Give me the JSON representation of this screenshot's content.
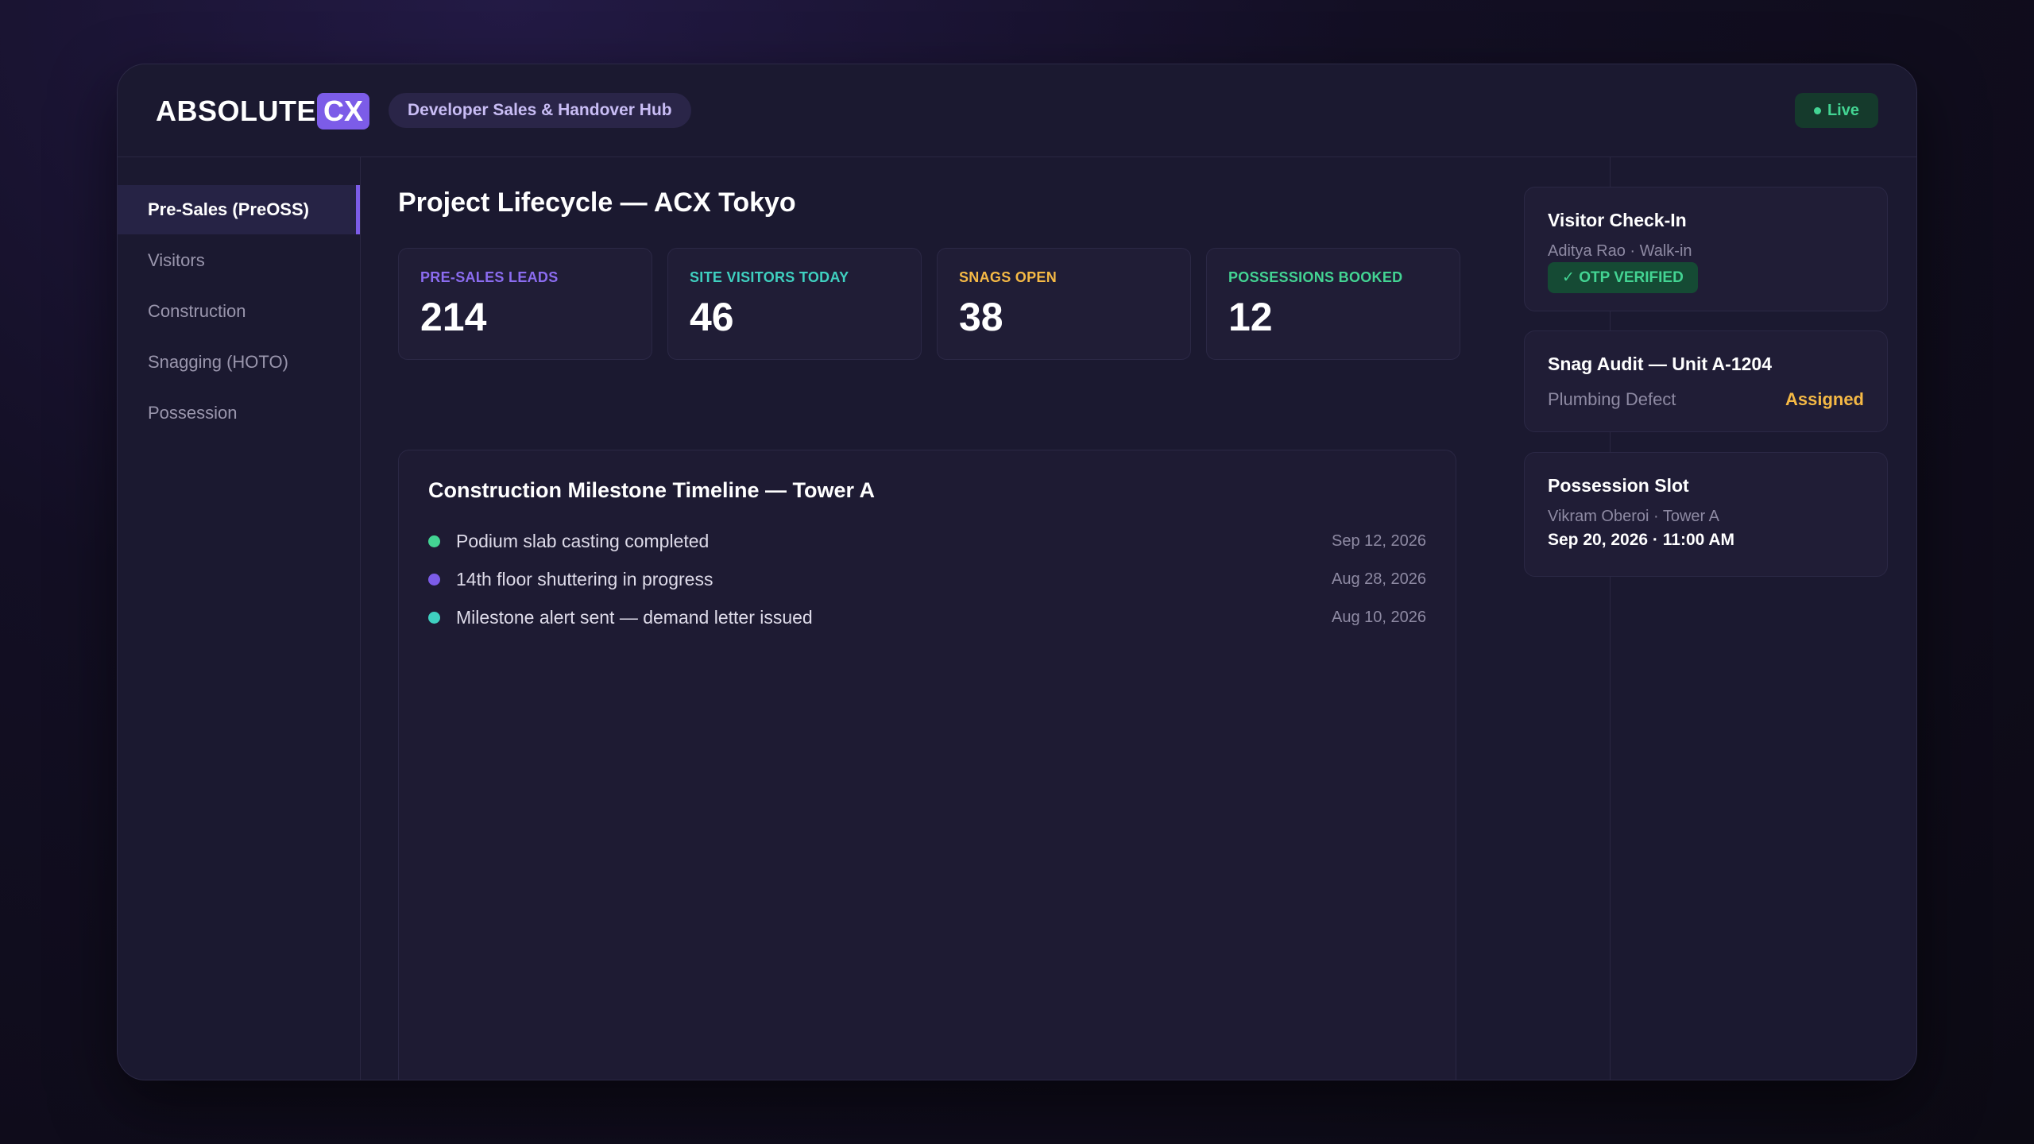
{
  "brand": {
    "name": "ABSOLUTE",
    "accent": "CX",
    "accent_color": "#7c5ce8"
  },
  "header": {
    "hub_label": "Developer Sales & Handover Hub",
    "status": "Live",
    "status_color": "#43d493"
  },
  "sidebar": {
    "items": [
      {
        "label": "Pre-Sales (PreOSS)",
        "active": true
      },
      {
        "label": "Visitors",
        "active": false
      },
      {
        "label": "Construction",
        "active": false
      },
      {
        "label": "Snagging (HOTO)",
        "active": false
      },
      {
        "label": "Possession",
        "active": false
      }
    ]
  },
  "main": {
    "title": "Project Lifecycle — ACX Tokyo",
    "stats": [
      {
        "label": "PRE-SALES LEADS",
        "value": "214",
        "color": "#8b6cf0"
      },
      {
        "label": "SITE VISITORS TODAY",
        "value": "46",
        "color": "#3fd0c0"
      },
      {
        "label": "SNAGS OPEN",
        "value": "38",
        "color": "#f5b945"
      },
      {
        "label": "POSSESSIONS BOOKED",
        "value": "12",
        "color": "#43d493"
      }
    ],
    "timeline": {
      "title": "Construction Milestone Timeline — Tower A",
      "events": [
        {
          "text": "Podium slab casting completed",
          "date": "Sep 12, 2026",
          "color": "#43d493"
        },
        {
          "text": "14th floor shuttering in progress",
          "date": "Aug 28, 2026",
          "color": "#7c5ce8"
        },
        {
          "text": "Milestone alert sent — demand letter issued",
          "date": "Aug 10, 2026",
          "color": "#3fd0c0"
        }
      ]
    }
  },
  "right_panel": {
    "visitor_checkin": {
      "title": "Visitor Check-In",
      "visitor": "Aditya Rao · Walk-in",
      "badge": "✓ OTP VERIFIED"
    },
    "snag_audit": {
      "title": "Snag Audit — Unit A-1204",
      "defect": "Plumbing Defect",
      "status": "Assigned"
    },
    "possession_slot": {
      "title": "Possession Slot",
      "customer": "Vikram Oberoi · Tower A",
      "time": "Sep 20, 2026 · 11:00 AM"
    }
  }
}
